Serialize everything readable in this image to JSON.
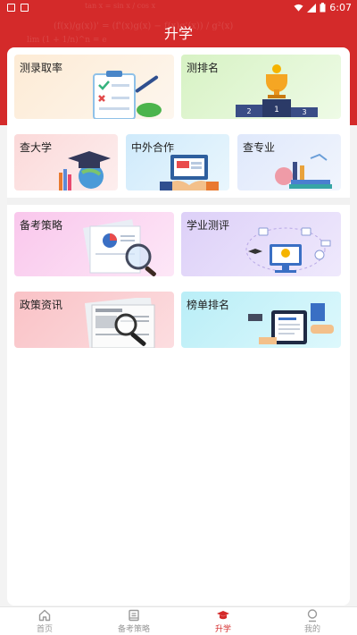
{
  "status_bar": {
    "time": "6:07"
  },
  "page": {
    "title": "升学"
  },
  "header_deco": {
    "formula_1": "tan x = sin x / cos x",
    "formula_2": "(f(x)/g(x))' = (f'(x)g(x) − f(x)g'(x)) / g²(x)",
    "formula_3": "lim (1 + 1/n)^n = e"
  },
  "cards": [
    {
      "label": "测录取率",
      "bg": "#fdf2e4"
    },
    {
      "label": "测排名",
      "bg": "#e6f7d8"
    },
    {
      "label": "查大学",
      "bg": "#fde4e4"
    },
    {
      "label": "中外合作",
      "bg": "#dcf0fb"
    },
    {
      "label": "查专业",
      "bg": "#e7eefb"
    },
    {
      "label": "备考策略",
      "bg": "#fbdaf1"
    },
    {
      "label": "学业测评",
      "bg": "#e7dcfa"
    },
    {
      "label": "政策资讯",
      "bg": "#fbd3d6"
    },
    {
      "label": "榜单排名",
      "bg": "#cdf3f8"
    }
  ],
  "tabs": [
    {
      "label": "首页",
      "icon": "home-icon"
    },
    {
      "label": "备考策略",
      "icon": "book-icon"
    },
    {
      "label": "升学",
      "icon": "graduation-cap-icon"
    },
    {
      "label": "我的",
      "icon": "user-icon"
    }
  ],
  "colors": {
    "brand": "#d42a2a",
    "inactive": "#9a9a9a"
  }
}
